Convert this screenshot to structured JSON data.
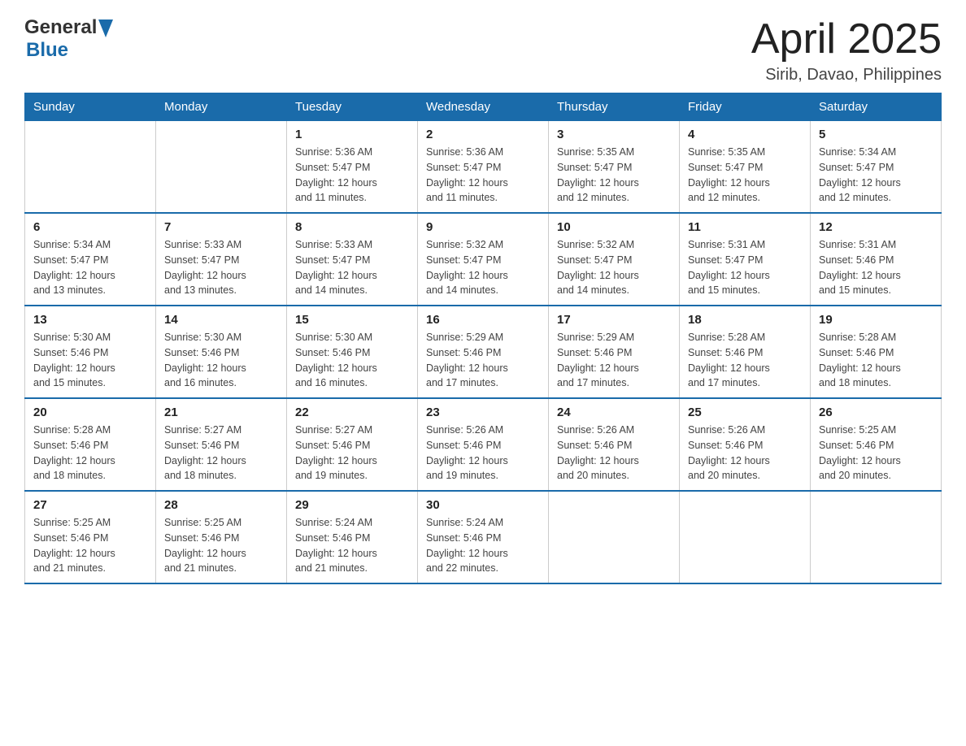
{
  "header": {
    "logo": {
      "text_general": "General",
      "text_blue": "Blue",
      "alt": "GeneralBlue Logo"
    },
    "title": "April 2025",
    "subtitle": "Sirib, Davao, Philippines"
  },
  "calendar": {
    "days_of_week": [
      "Sunday",
      "Monday",
      "Tuesday",
      "Wednesday",
      "Thursday",
      "Friday",
      "Saturday"
    ],
    "weeks": [
      [
        {
          "day": "",
          "info": ""
        },
        {
          "day": "",
          "info": ""
        },
        {
          "day": "1",
          "info": "Sunrise: 5:36 AM\nSunset: 5:47 PM\nDaylight: 12 hours\nand 11 minutes."
        },
        {
          "day": "2",
          "info": "Sunrise: 5:36 AM\nSunset: 5:47 PM\nDaylight: 12 hours\nand 11 minutes."
        },
        {
          "day": "3",
          "info": "Sunrise: 5:35 AM\nSunset: 5:47 PM\nDaylight: 12 hours\nand 12 minutes."
        },
        {
          "day": "4",
          "info": "Sunrise: 5:35 AM\nSunset: 5:47 PM\nDaylight: 12 hours\nand 12 minutes."
        },
        {
          "day": "5",
          "info": "Sunrise: 5:34 AM\nSunset: 5:47 PM\nDaylight: 12 hours\nand 12 minutes."
        }
      ],
      [
        {
          "day": "6",
          "info": "Sunrise: 5:34 AM\nSunset: 5:47 PM\nDaylight: 12 hours\nand 13 minutes."
        },
        {
          "day": "7",
          "info": "Sunrise: 5:33 AM\nSunset: 5:47 PM\nDaylight: 12 hours\nand 13 minutes."
        },
        {
          "day": "8",
          "info": "Sunrise: 5:33 AM\nSunset: 5:47 PM\nDaylight: 12 hours\nand 14 minutes."
        },
        {
          "day": "9",
          "info": "Sunrise: 5:32 AM\nSunset: 5:47 PM\nDaylight: 12 hours\nand 14 minutes."
        },
        {
          "day": "10",
          "info": "Sunrise: 5:32 AM\nSunset: 5:47 PM\nDaylight: 12 hours\nand 14 minutes."
        },
        {
          "day": "11",
          "info": "Sunrise: 5:31 AM\nSunset: 5:47 PM\nDaylight: 12 hours\nand 15 minutes."
        },
        {
          "day": "12",
          "info": "Sunrise: 5:31 AM\nSunset: 5:46 PM\nDaylight: 12 hours\nand 15 minutes."
        }
      ],
      [
        {
          "day": "13",
          "info": "Sunrise: 5:30 AM\nSunset: 5:46 PM\nDaylight: 12 hours\nand 15 minutes."
        },
        {
          "day": "14",
          "info": "Sunrise: 5:30 AM\nSunset: 5:46 PM\nDaylight: 12 hours\nand 16 minutes."
        },
        {
          "day": "15",
          "info": "Sunrise: 5:30 AM\nSunset: 5:46 PM\nDaylight: 12 hours\nand 16 minutes."
        },
        {
          "day": "16",
          "info": "Sunrise: 5:29 AM\nSunset: 5:46 PM\nDaylight: 12 hours\nand 17 minutes."
        },
        {
          "day": "17",
          "info": "Sunrise: 5:29 AM\nSunset: 5:46 PM\nDaylight: 12 hours\nand 17 minutes."
        },
        {
          "day": "18",
          "info": "Sunrise: 5:28 AM\nSunset: 5:46 PM\nDaylight: 12 hours\nand 17 minutes."
        },
        {
          "day": "19",
          "info": "Sunrise: 5:28 AM\nSunset: 5:46 PM\nDaylight: 12 hours\nand 18 minutes."
        }
      ],
      [
        {
          "day": "20",
          "info": "Sunrise: 5:28 AM\nSunset: 5:46 PM\nDaylight: 12 hours\nand 18 minutes."
        },
        {
          "day": "21",
          "info": "Sunrise: 5:27 AM\nSunset: 5:46 PM\nDaylight: 12 hours\nand 18 minutes."
        },
        {
          "day": "22",
          "info": "Sunrise: 5:27 AM\nSunset: 5:46 PM\nDaylight: 12 hours\nand 19 minutes."
        },
        {
          "day": "23",
          "info": "Sunrise: 5:26 AM\nSunset: 5:46 PM\nDaylight: 12 hours\nand 19 minutes."
        },
        {
          "day": "24",
          "info": "Sunrise: 5:26 AM\nSunset: 5:46 PM\nDaylight: 12 hours\nand 20 minutes."
        },
        {
          "day": "25",
          "info": "Sunrise: 5:26 AM\nSunset: 5:46 PM\nDaylight: 12 hours\nand 20 minutes."
        },
        {
          "day": "26",
          "info": "Sunrise: 5:25 AM\nSunset: 5:46 PM\nDaylight: 12 hours\nand 20 minutes."
        }
      ],
      [
        {
          "day": "27",
          "info": "Sunrise: 5:25 AM\nSunset: 5:46 PM\nDaylight: 12 hours\nand 21 minutes."
        },
        {
          "day": "28",
          "info": "Sunrise: 5:25 AM\nSunset: 5:46 PM\nDaylight: 12 hours\nand 21 minutes."
        },
        {
          "day": "29",
          "info": "Sunrise: 5:24 AM\nSunset: 5:46 PM\nDaylight: 12 hours\nand 21 minutes."
        },
        {
          "day": "30",
          "info": "Sunrise: 5:24 AM\nSunset: 5:46 PM\nDaylight: 12 hours\nand 22 minutes."
        },
        {
          "day": "",
          "info": ""
        },
        {
          "day": "",
          "info": ""
        },
        {
          "day": "",
          "info": ""
        }
      ]
    ]
  }
}
